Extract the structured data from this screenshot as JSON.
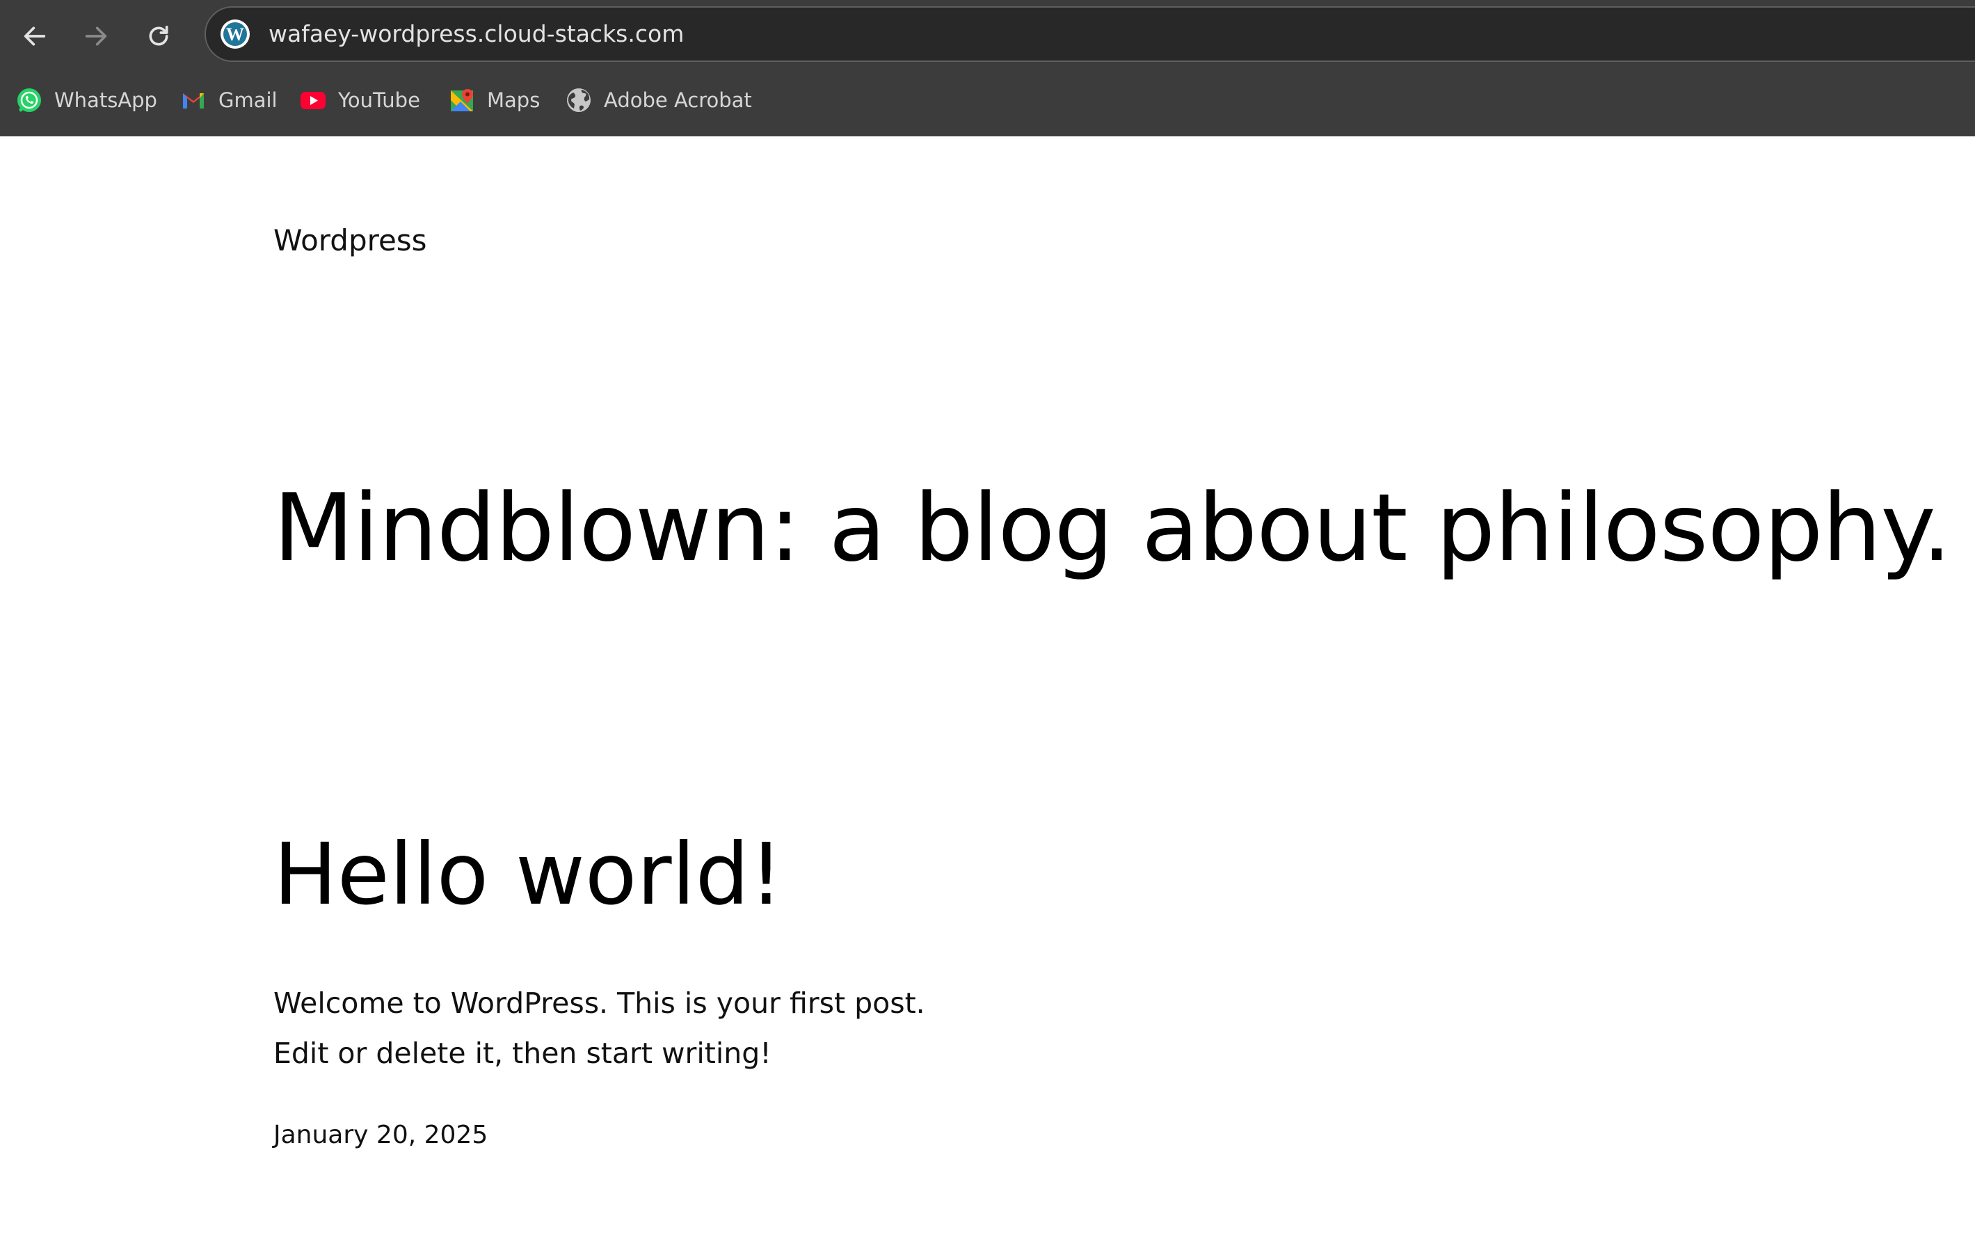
{
  "browser": {
    "url": "wafaey-wordpress.cloud-stacks.com",
    "back_icon": "arrow-left-icon",
    "forward_icon": "arrow-right-icon",
    "reload_icon": "reload-icon",
    "site_icon": "wordpress-logo-icon",
    "bookmarks": [
      {
        "label": "WhatsApp",
        "icon": "whatsapp-icon",
        "color": "#25d366"
      },
      {
        "label": "Gmail",
        "icon": "gmail-icon",
        "color": "#ea4335"
      },
      {
        "label": "YouTube",
        "icon": "youtube-icon",
        "color": "#ff0033"
      },
      {
        "label": "Maps",
        "icon": "google-maps-icon",
        "color": "#34a853"
      },
      {
        "label": "Adobe Acrobat",
        "icon": "globe-icon",
        "color": "#c7c7c7"
      }
    ]
  },
  "site": {
    "title": "Wordpress",
    "tagline": "Mindblown: a blog about philosophy."
  },
  "post": {
    "title": "Hello world!",
    "excerpt_line1": "Welcome to WordPress. This is your first post.",
    "excerpt_line2": "Edit or delete it, then start writing!",
    "date": "January 20, 2025"
  }
}
